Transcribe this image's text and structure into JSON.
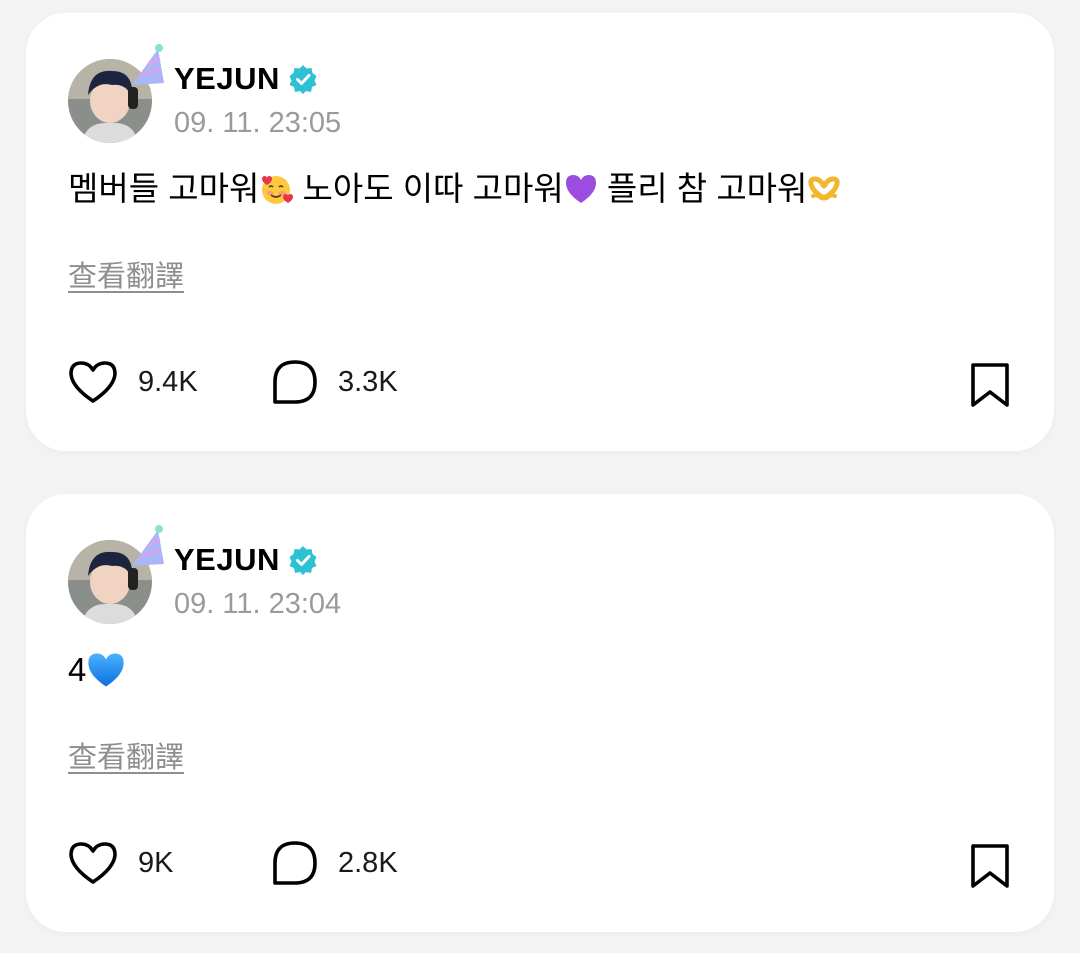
{
  "posts": [
    {
      "author": "YEJUN",
      "timestamp": "09. 11. 23:05",
      "text_parts": [
        "멤버들 고마워",
        " 노아도 이따 고마워",
        " 플리 참 고마워"
      ],
      "translate_label": "查看翻譯",
      "likes": "9.4K",
      "comments": "3.3K"
    },
    {
      "author": "YEJUN",
      "timestamp": "09. 11. 23:04",
      "text_parts": [
        "4"
      ],
      "translate_label": "查看翻譯",
      "likes": "9K",
      "comments": "2.8K"
    }
  ],
  "colors": {
    "verified": "#2cc2d3",
    "timestamp": "#9a9a9a",
    "link": "#8e8e8e",
    "purple_heart": "#9b4de0",
    "blue_heart": "#1e8fff"
  },
  "icons": [
    "party-hat-icon",
    "verified-badge-icon",
    "heart-icon",
    "comment-bubble-icon",
    "bookmark-icon",
    "smiling-face-with-hearts-emoji",
    "purple-heart-emoji",
    "heart-hands-emoji",
    "blue-heart-emoji"
  ]
}
